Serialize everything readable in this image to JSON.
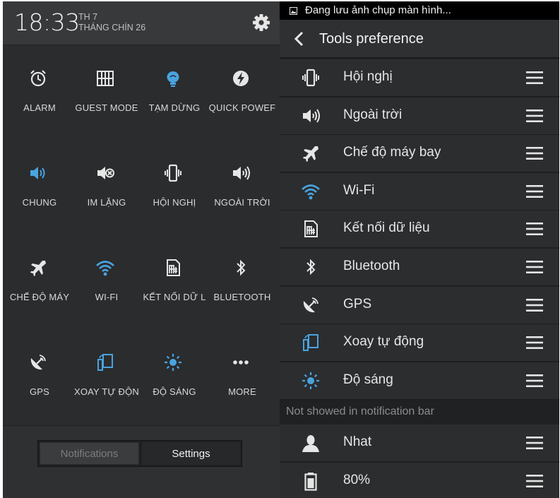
{
  "left": {
    "time": "18:33",
    "day": "TH 7",
    "month": "THÁNG CHÍN 26",
    "tiles": [
      {
        "label": "ALARM",
        "icon": "alarm-icon",
        "active": false
      },
      {
        "label": "GUEST MODE",
        "icon": "guest-mode-icon",
        "active": false
      },
      {
        "label": "TẠM DỪNG",
        "icon": "lamp-icon",
        "active": true
      },
      {
        "label": "QUICK POWEF",
        "icon": "quick-power-icon",
        "active": false
      },
      {
        "label": "CHUNG",
        "icon": "speaker-icon",
        "active": true
      },
      {
        "label": "IM LẶNG",
        "icon": "mute-icon",
        "active": false
      },
      {
        "label": "HỘI NGHỊ",
        "icon": "vibrate-icon",
        "active": false
      },
      {
        "label": "NGOÀI TRỜI",
        "icon": "outdoor-speaker-icon",
        "active": false
      },
      {
        "label": "CHẾ ĐỘ MÁY",
        "icon": "airplane-icon",
        "active": false
      },
      {
        "label": "WI-FI",
        "icon": "wifi-icon",
        "active": true
      },
      {
        "label": "KẾT NỐI DỮ L",
        "icon": "data-sim-icon",
        "active": false
      },
      {
        "label": "BLUETOOTH",
        "icon": "bluetooth-icon",
        "active": false
      },
      {
        "label": "GPS",
        "icon": "gps-icon",
        "active": false
      },
      {
        "label": "XOAY TỰ ĐỘN",
        "icon": "rotate-icon",
        "active": true
      },
      {
        "label": "ĐỘ SÁNG",
        "icon": "brightness-icon",
        "active": true
      },
      {
        "label": "MORE",
        "icon": "more-icon",
        "active": false
      }
    ],
    "footer": {
      "notifications": "Notifications",
      "settings": "Settings"
    }
  },
  "right": {
    "status_text": "Đang lưu ảnh chụp màn hình...",
    "title": "Tools preference",
    "items": [
      {
        "label": "Hội nghị",
        "icon": "vibrate-icon",
        "active": false
      },
      {
        "label": "Ngoài trời",
        "icon": "outdoor-speaker-icon",
        "active": false
      },
      {
        "label": "Chế độ máy bay",
        "icon": "airplane-icon",
        "active": false
      },
      {
        "label": "Wi-Fi",
        "icon": "wifi-icon",
        "active": true
      },
      {
        "label": "Kết nối dữ liệu",
        "icon": "data-sim-icon",
        "active": false
      },
      {
        "label": "Bluetooth",
        "icon": "bluetooth-icon",
        "active": false
      },
      {
        "label": "GPS",
        "icon": "gps-icon",
        "active": false
      },
      {
        "label": "Xoay tự động",
        "icon": "rotate-icon",
        "active": true
      },
      {
        "label": "Độ sáng",
        "icon": "brightness-icon",
        "active": true
      }
    ],
    "section_label": "Not showed in notification bar",
    "hidden_items": [
      {
        "label": "Nhat",
        "icon": "user-icon",
        "active": false
      },
      {
        "label": "80%",
        "icon": "battery-icon",
        "active": false
      }
    ]
  },
  "colors": {
    "accent": "#4aa3df",
    "icon": "#e6e6e6"
  }
}
